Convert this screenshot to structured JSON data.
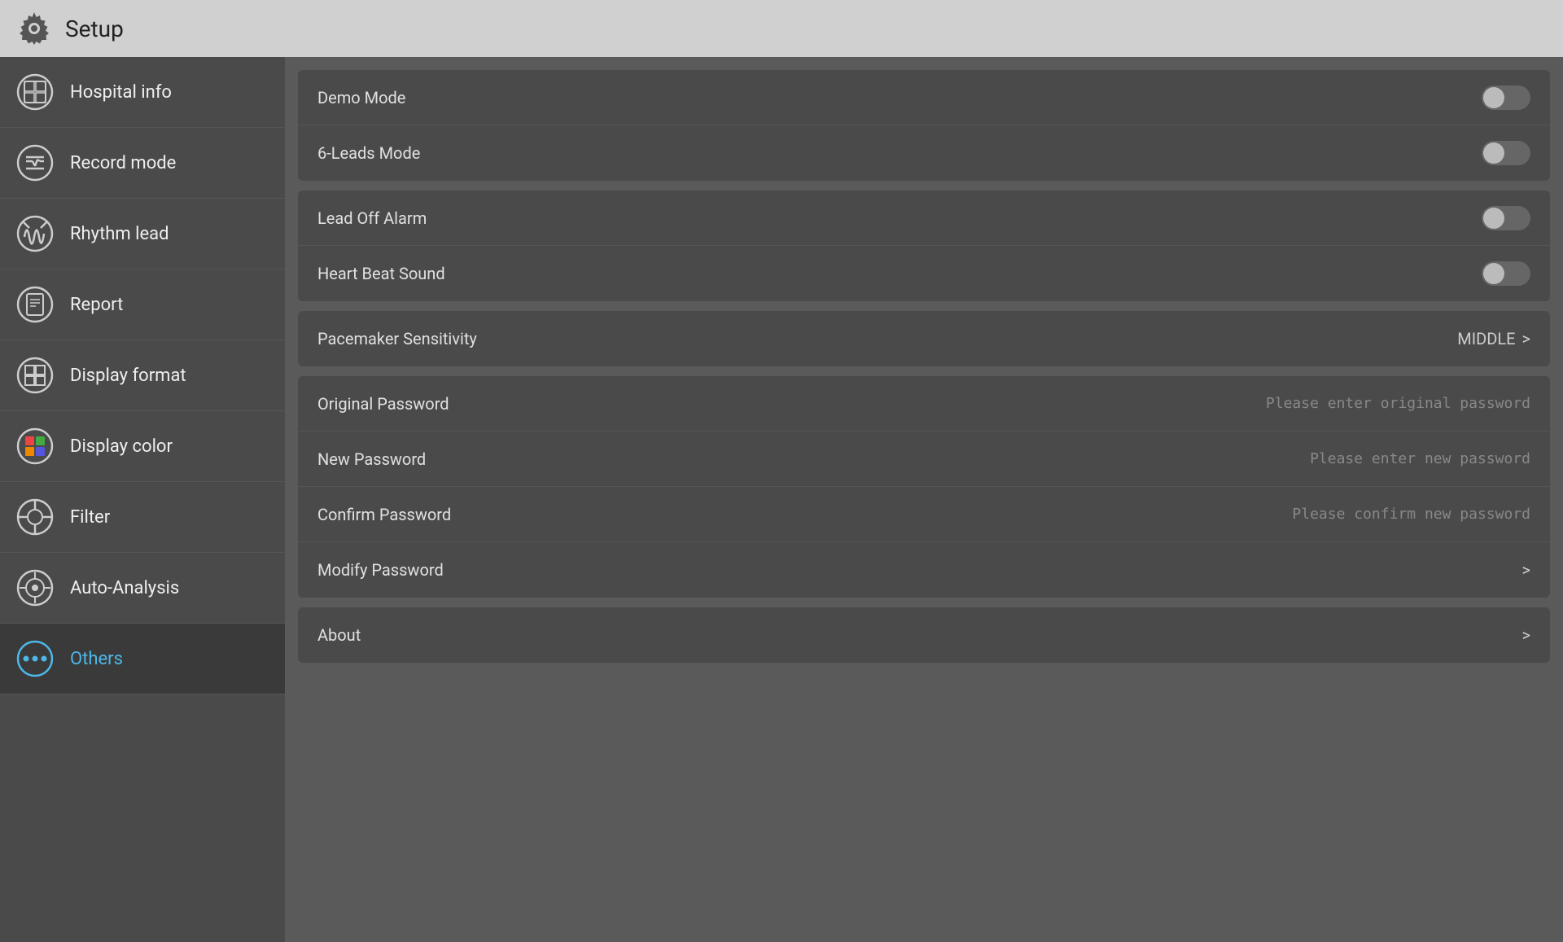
{
  "header": {
    "title": "Setup"
  },
  "sidebar": {
    "items": [
      {
        "id": "hospital-info",
        "label": "Hospital info",
        "active": false,
        "icon": "hospital"
      },
      {
        "id": "record-mode",
        "label": "Record mode",
        "active": false,
        "icon": "record"
      },
      {
        "id": "rhythm-lead",
        "label": "Rhythm lead",
        "active": false,
        "icon": "rhythm"
      },
      {
        "id": "report",
        "label": "Report",
        "active": false,
        "icon": "report"
      },
      {
        "id": "display-format",
        "label": "Display format",
        "active": false,
        "icon": "display-format"
      },
      {
        "id": "display-color",
        "label": "Display color",
        "active": false,
        "icon": "display-color"
      },
      {
        "id": "filter",
        "label": "Filter",
        "active": false,
        "icon": "filter"
      },
      {
        "id": "auto-analysis",
        "label": "Auto-Analysis",
        "active": false,
        "icon": "auto-analysis"
      },
      {
        "id": "others",
        "label": "Others",
        "active": true,
        "icon": "others"
      }
    ]
  },
  "content": {
    "toggles_card": {
      "rows": [
        {
          "id": "demo-mode",
          "label": "Demo Mode",
          "type": "toggle",
          "state": "off"
        },
        {
          "id": "6leads-mode",
          "label": "6-Leads Mode",
          "type": "toggle",
          "state": "off"
        },
        {
          "id": "lead-off-alarm",
          "label": "Lead Off Alarm",
          "type": "toggle",
          "state": "off"
        },
        {
          "id": "heartbeat-sound",
          "label": "Heart Beat Sound",
          "type": "toggle",
          "state": "off"
        }
      ]
    },
    "pacemaker_card": {
      "label": "Pacemaker Sensitivity",
      "value": "MIDDLE",
      "arrow": ">"
    },
    "password_card": {
      "rows": [
        {
          "id": "original-password",
          "label": "Original Password",
          "placeholder": "Please enter original password"
        },
        {
          "id": "new-password",
          "label": "New Password",
          "placeholder": "Please enter new password"
        },
        {
          "id": "confirm-password",
          "label": "Confirm Password",
          "placeholder": "Please confirm new password"
        },
        {
          "id": "modify-password",
          "label": "Modify Password",
          "type": "arrow",
          "arrow": ">"
        }
      ]
    },
    "about_card": {
      "label": "About",
      "arrow": ">"
    }
  }
}
